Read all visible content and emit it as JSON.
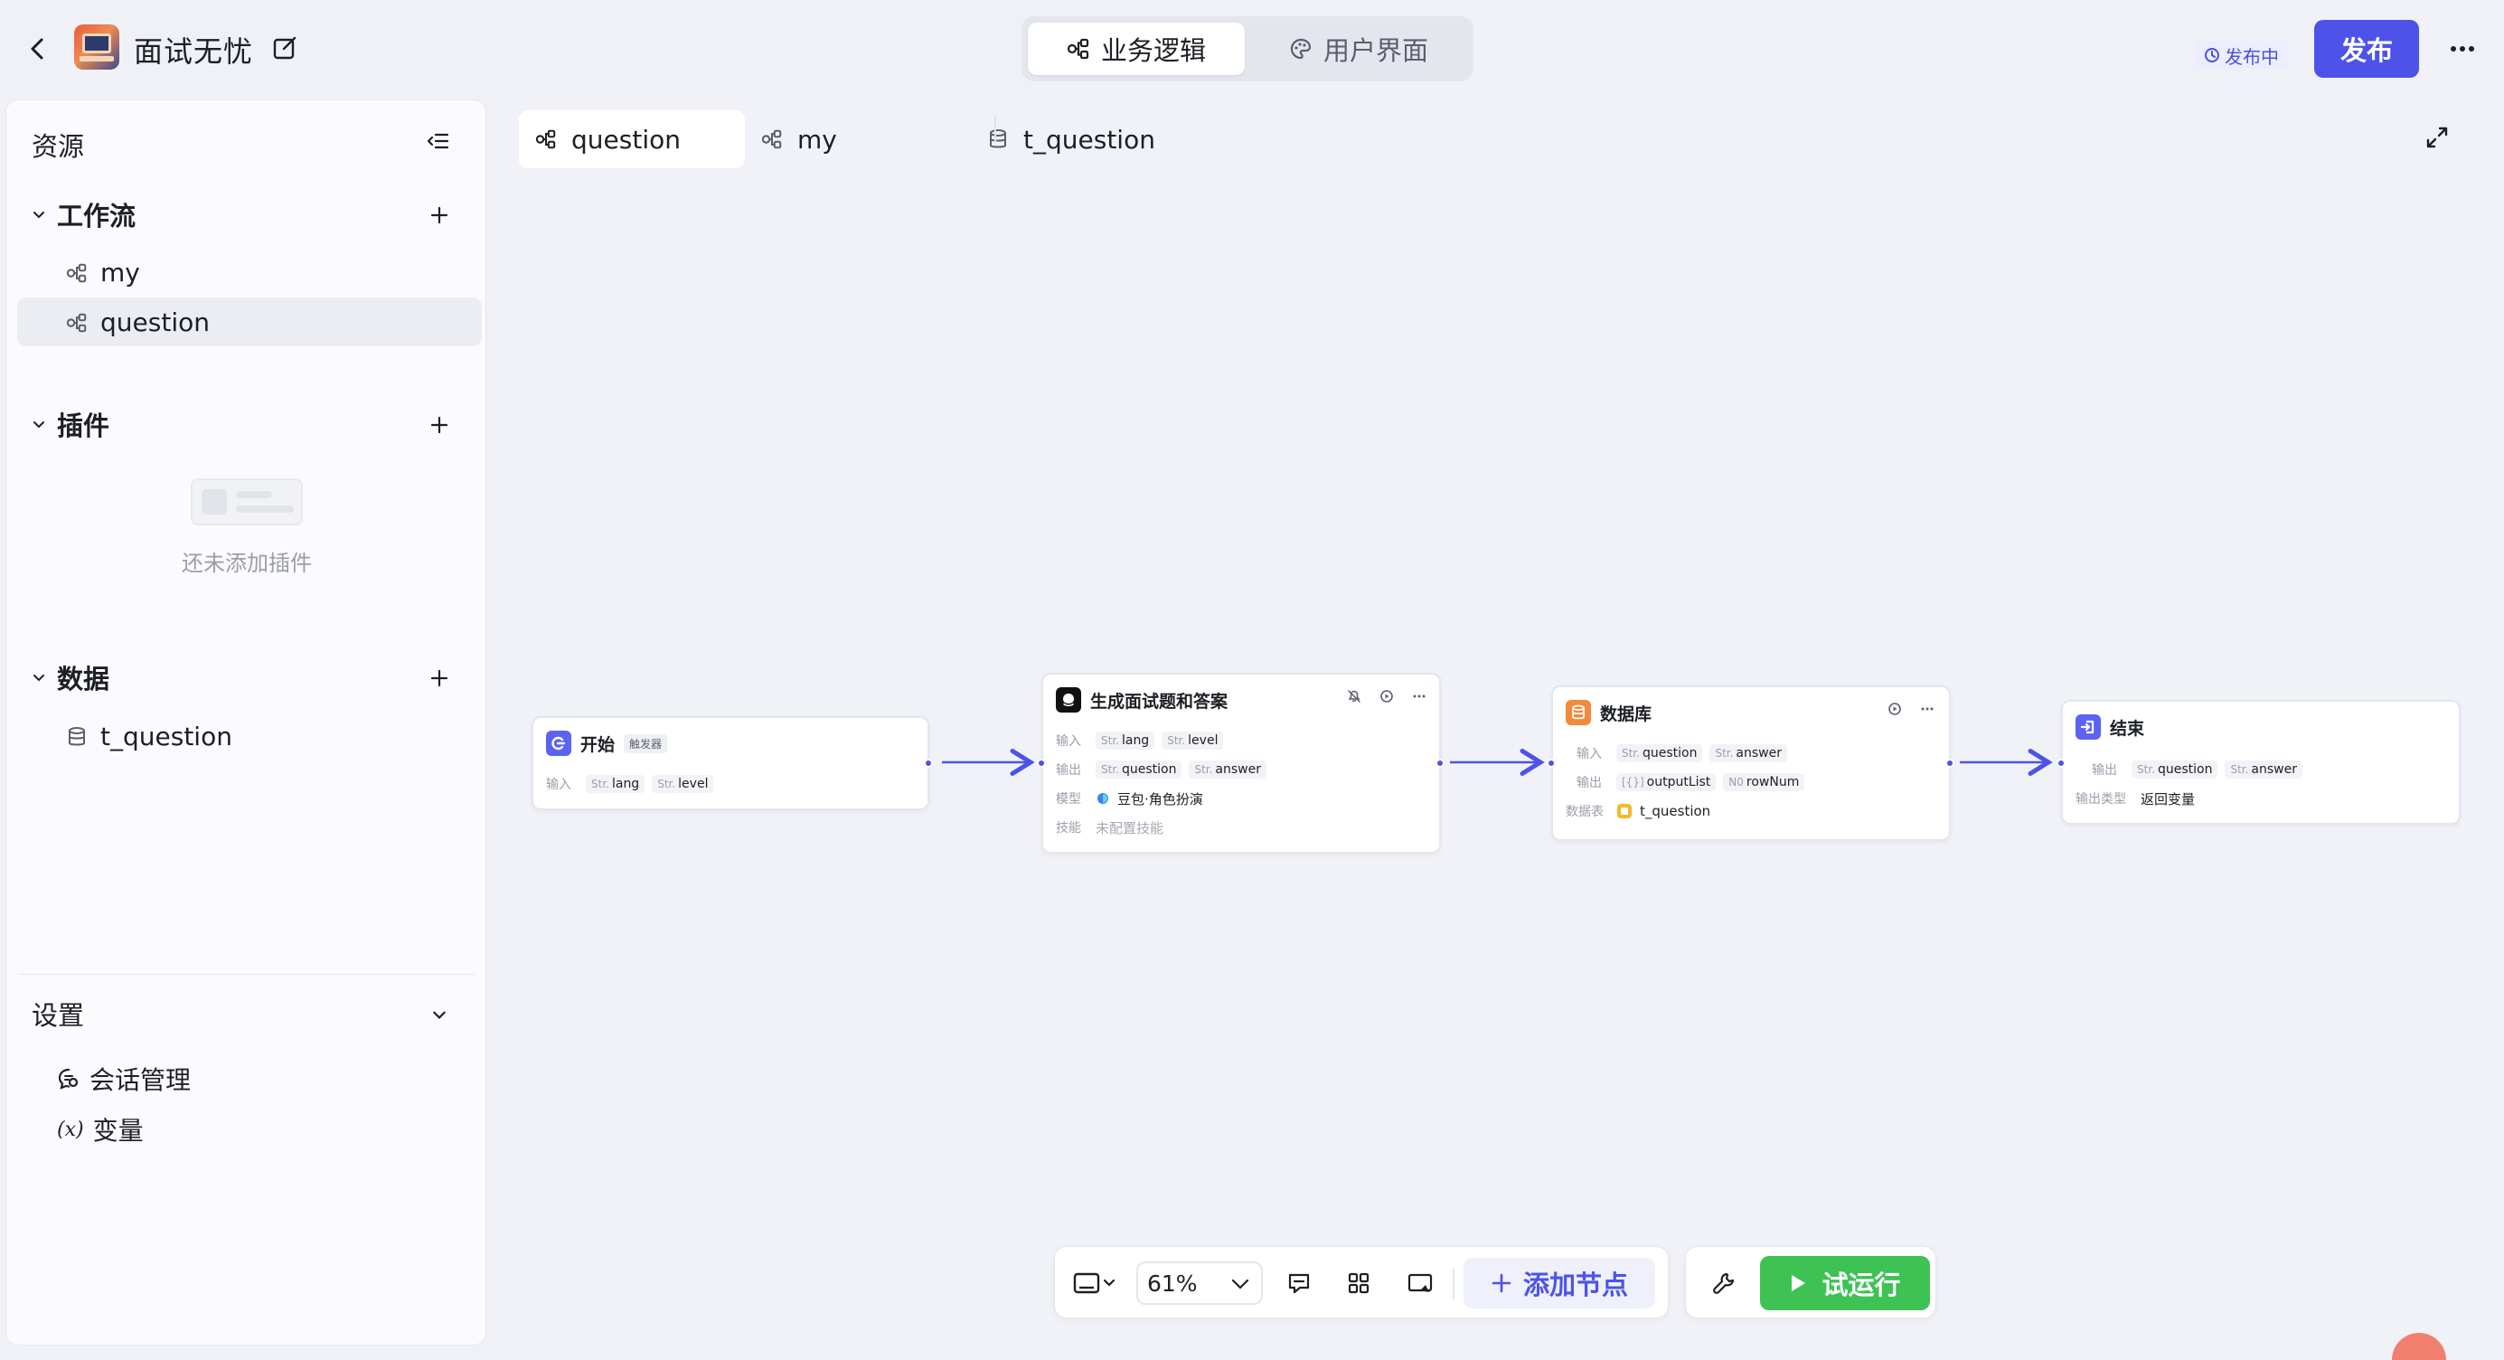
{
  "header": {
    "app_title": "面试无忧",
    "mode_tabs": [
      {
        "label": "业务逻辑",
        "active": true
      },
      {
        "label": "用户界面",
        "active": false
      }
    ],
    "status": "发布中",
    "publish_label": "发布"
  },
  "sidebar": {
    "title": "资源",
    "sections": {
      "workflow": {
        "label": "工作流",
        "items": [
          "my",
          "question"
        ],
        "active_item": "question"
      },
      "plugins": {
        "label": "插件",
        "empty_text": "还未添加插件"
      },
      "data": {
        "label": "数据",
        "items": [
          "t_question"
        ]
      },
      "settings": {
        "label": "设置",
        "items": [
          "会话管理",
          "变量"
        ]
      }
    }
  },
  "canvas": {
    "tabs": [
      {
        "label": "question",
        "icon": "workflow-icon",
        "active": true
      },
      {
        "label": "my",
        "icon": "workflow-icon",
        "active": false
      },
      {
        "label": "t_question",
        "icon": "database-icon",
        "active": false
      }
    ],
    "nodes": {
      "start": {
        "title": "开始",
        "badge": "触发器",
        "input_label": "输入",
        "inputs": [
          {
            "type": "Str.",
            "name": "lang"
          },
          {
            "type": "Str.",
            "name": "level"
          }
        ]
      },
      "llm": {
        "title": "生成面试题和答案",
        "input_label": "输入",
        "inputs": [
          {
            "type": "Str.",
            "name": "lang"
          },
          {
            "type": "Str.",
            "name": "level"
          }
        ],
        "output_label": "输出",
        "outputs": [
          {
            "type": "Str.",
            "name": "question"
          },
          {
            "type": "Str.",
            "name": "answer"
          }
        ],
        "model_label": "模型",
        "model": "豆包·角色扮演",
        "skills_label": "技能",
        "skills": "未配置技能"
      },
      "database": {
        "title": "数据库",
        "input_label": "输入",
        "inputs": [
          {
            "type": "Str.",
            "name": "question"
          },
          {
            "type": "Str.",
            "name": "answer"
          }
        ],
        "output_label": "输出",
        "outputs": [
          {
            "type": "[{}]",
            "name": "outputList"
          },
          {
            "type": "N0",
            "name": "rowNum"
          }
        ],
        "table_label": "数据表",
        "table": "t_question"
      },
      "end": {
        "title": "结束",
        "output_label": "输出",
        "outputs": [
          {
            "type": "Str.",
            "name": "question"
          },
          {
            "type": "Str.",
            "name": "answer"
          }
        ],
        "output_type_label": "输出类型",
        "output_type": "返回变量"
      }
    }
  },
  "toolbar": {
    "zoom": "61%",
    "add_node_label": "添加节点",
    "run_label": "试运行"
  },
  "colors": {
    "accent": "#4d53e8",
    "run_green": "#3ec254",
    "db_orange": "#f08a3c",
    "start_blue": "#5b63f0"
  }
}
